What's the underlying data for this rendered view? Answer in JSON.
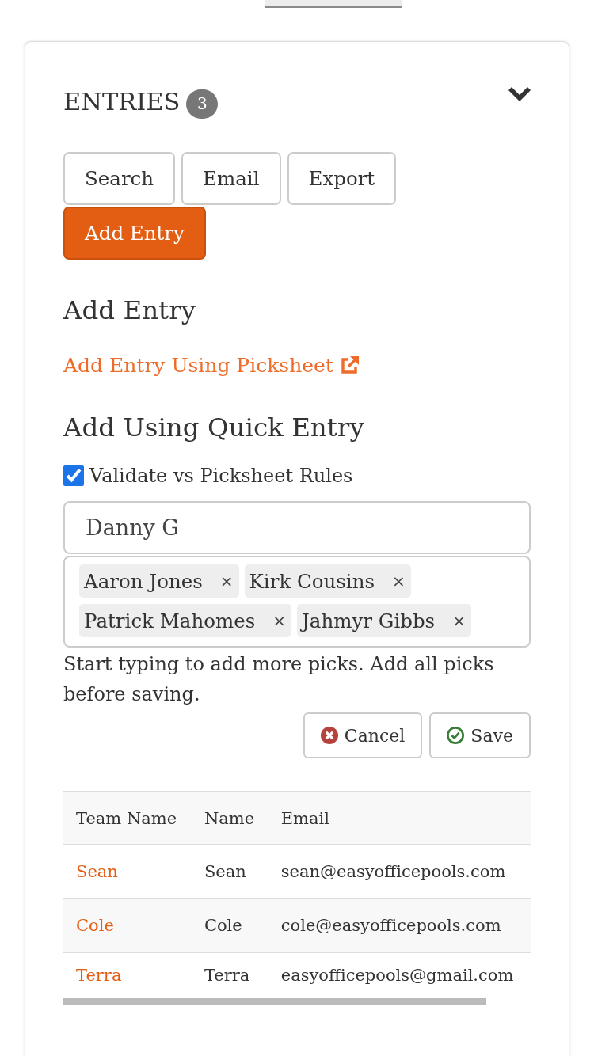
{
  "entries": {
    "title": "ENTRIES",
    "count": "3"
  },
  "toolbar": {
    "buttons": [
      {
        "label": "Search",
        "kind": "default"
      },
      {
        "label": "Email",
        "kind": "default"
      },
      {
        "label": "Export",
        "kind": "default"
      },
      {
        "label": "Add Entry",
        "kind": "primary"
      }
    ]
  },
  "add_entry": {
    "heading": "Add Entry",
    "picksheet_link": "Add Entry Using Picksheet"
  },
  "quick_entry": {
    "heading": "Add Using Quick Entry",
    "validate": {
      "label": "Validate vs Picksheet Rules",
      "checked": true
    },
    "name_field": {
      "value": "Danny G"
    },
    "picks": [
      {
        "label": "Aaron Jones",
        "remove": "×"
      },
      {
        "label": "Kirk Cousins",
        "remove": "×"
      },
      {
        "label": "Patrick Mahomes",
        "remove": "×"
      },
      {
        "label": "Jahmyr Gibbs",
        "remove": "×"
      }
    ],
    "help": "Start typing to add more picks. Add all picks before saving.",
    "actions": [
      {
        "label": "Cancel",
        "kind": "cancel"
      },
      {
        "label": "Save",
        "kind": "save"
      }
    ]
  },
  "table": {
    "columns": [
      "Team Name",
      "Name",
      "Email"
    ],
    "rows": [
      {
        "team_name": "Sean",
        "name": "Sean",
        "email": "sean@easyofficepools.com"
      },
      {
        "team_name": "Cole",
        "name": "Cole",
        "email": "cole@easyofficepools.com"
      },
      {
        "team_name": "Terra",
        "name": "Terra",
        "email": "easyofficepools@gmail.com"
      }
    ]
  }
}
